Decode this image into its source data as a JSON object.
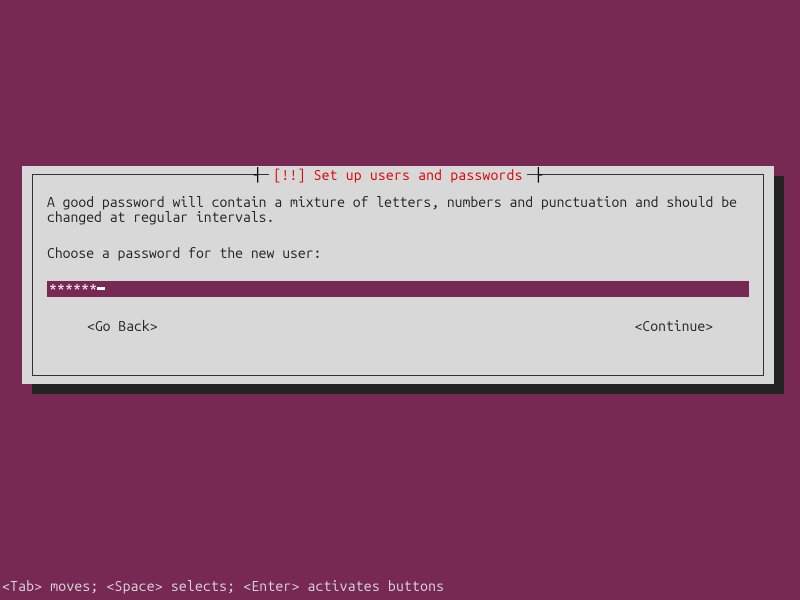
{
  "dialog": {
    "title": "[!!] Set up users and passwords",
    "description": "A good password will contain a mixture of letters, numbers and punctuation and should be\nchanged at regular intervals.",
    "prompt": "Choose a password for the new user:",
    "input": {
      "masked_value": "******"
    },
    "buttons": {
      "back": "<Go Back>",
      "continue": "<Continue>"
    }
  },
  "footer": {
    "hint": "<Tab> moves; <Space> selects; <Enter> activates buttons"
  }
}
